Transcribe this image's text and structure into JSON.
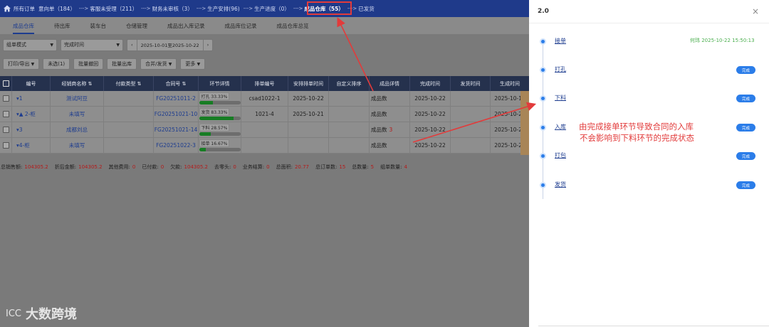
{
  "workflow_bar": {
    "home_label": "所有订单",
    "steps": [
      {
        "label": "意向单（184）"
      },
      {
        "label": "客服未受理（211）"
      },
      {
        "label": "财务未审核（3）"
      },
      {
        "label": "生产安排(96)"
      },
      {
        "label": "生产进度（0）"
      },
      {
        "label": "成品仓库（55）"
      },
      {
        "label": "已发货"
      }
    ],
    "arrow": "--->"
  },
  "sub_tabs": [
    "成品仓库",
    "待出库",
    "装车台",
    "仓储管理",
    "成品出入库记录",
    "成品库位记录",
    "成品仓库总览"
  ],
  "filters": {
    "mode": "组单模式",
    "time_type": "完成时间",
    "date_range": "2025-10-01至2025-10-22"
  },
  "actions": [
    "打印/导出",
    "未选(1)",
    "批量撤回",
    "批量出库",
    "合并/发货",
    "更多"
  ],
  "table": {
    "headers": [
      "编号",
      "经销商名称",
      "付款类型",
      "合同号",
      "环节详情",
      "排单编号",
      "安排排单时间",
      "自定义排序",
      "成品详情",
      "完成时间",
      "发货时间",
      "生成时间"
    ],
    "rows": [
      {
        "id": "1",
        "dealer": "测试阿豆",
        "pay": "",
        "contract": "FG20251011-2",
        "stage": "打孔 33.33%",
        "progress": 0.3333,
        "sched_no": "csad1022-1",
        "sched_time": "2025-10-22",
        "custom": "",
        "detail": "成品数",
        "detail_num": "",
        "done": "2025-10-22",
        "ship": "",
        "created": "2025-10-11"
      },
      {
        "id": "▲ 2-柜",
        "dealer": "未填写",
        "pay": "",
        "contract": "FG20251021-10",
        "stage": "发货 83.33%",
        "progress": 0.8333,
        "sched_no": "1021-4",
        "sched_time": "2025-10-21",
        "custom": "",
        "detail": "成品数",
        "detail_num": "",
        "done": "2025-10-22",
        "ship": "",
        "created": "2025-10-21"
      },
      {
        "id": "3",
        "dealer": "成都刘总",
        "pay": "",
        "contract": "FG20251021-14",
        "stage": "下料 28.57%",
        "progress": 0.2857,
        "sched_no": "",
        "sched_time": "",
        "custom": "",
        "detail": "成品数",
        "detail_num": "3",
        "done": "2025-10-22",
        "ship": "",
        "created": "2025-10-21"
      },
      {
        "id": "4-柜",
        "dealer": "未填写",
        "pay": "",
        "contract": "FG20251022-3",
        "stage": "接单 16.67%",
        "progress": 0.1667,
        "sched_no": "",
        "sched_time": "",
        "custom": "",
        "detail": "成品数",
        "detail_num": "",
        "done": "2025-10-22",
        "ship": "",
        "created": "2025-10-22"
      }
    ]
  },
  "summary": [
    {
      "label": "总销售额:",
      "value": "104305.2"
    },
    {
      "label": "折后金额:",
      "value": "104305.2"
    },
    {
      "label": "其他费用:",
      "value": "0"
    },
    {
      "label": "已付款:",
      "value": "0"
    },
    {
      "label": "欠款:",
      "value": "104305.2"
    },
    {
      "label": "去零头:",
      "value": "0"
    },
    {
      "label": "业务结算:",
      "value": "0"
    },
    {
      "label": "总面积:",
      "value": "20.77"
    },
    {
      "label": "总订单数:",
      "value": "15"
    },
    {
      "label": "总数量:",
      "value": "5"
    },
    {
      "label": "组单数量:",
      "value": "4"
    }
  ],
  "panel": {
    "title": "2.0",
    "timestamp": "何玮 2025-10-22 15:50:13",
    "nodes": [
      {
        "label": "接单",
        "badge": ""
      },
      {
        "label": "打孔",
        "badge": "完成"
      },
      {
        "label": "下料",
        "badge": "完成"
      },
      {
        "label": "入库",
        "badge": "完成"
      },
      {
        "label": "打包",
        "badge": "完成"
      },
      {
        "label": "发货",
        "badge": "完成"
      }
    ]
  },
  "annotation": {
    "line1": "由完成接单环节导致合同的入库",
    "line2": "不会影响到下料环节的完成状态",
    "color": "#e23b3b"
  },
  "watermark": {
    "logo": "ⅠⅭⅭ",
    "text": "大数跨境"
  }
}
